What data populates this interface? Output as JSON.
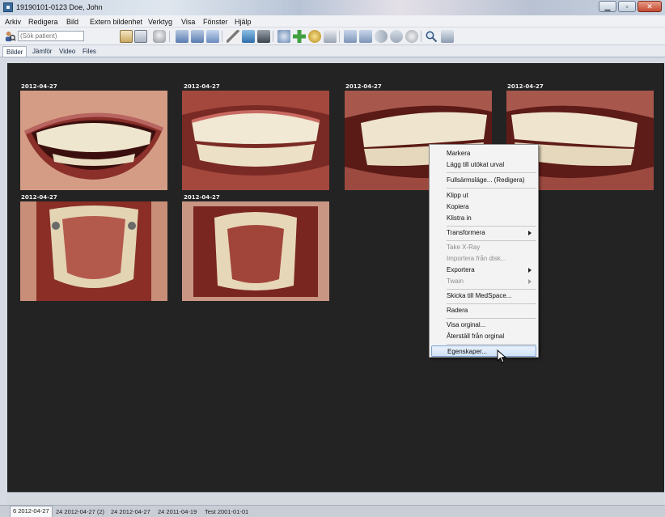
{
  "window": {
    "title": "19190101-0123 Doe, John"
  },
  "menubar": {
    "items": [
      "Arkiv",
      "Redigera",
      "Bild",
      "Extern bildenhet",
      "Verktyg",
      "Visa",
      "Fönster",
      "Hjälp"
    ]
  },
  "search": {
    "placeholder": "(Sök patient)"
  },
  "tabs": [
    "Bilder",
    "Jämför",
    "Video",
    "Files"
  ],
  "images": [
    {
      "date": "2012-04-27",
      "kind": "smile"
    },
    {
      "date": "2012-04-27",
      "kind": "frontal"
    },
    {
      "date": "2012-04-27",
      "kind": "right-lateral"
    },
    {
      "date": "2012-04-27",
      "kind": "left-lateral"
    },
    {
      "date": "2012-04-27",
      "kind": "upper-occlusal"
    },
    {
      "date": "2012-04-27",
      "kind": "lower-occlusal"
    }
  ],
  "context_menu": {
    "items": [
      {
        "label": "Markera"
      },
      {
        "label": "Lägg till utökat urval"
      },
      {
        "label": "Fullsärmsläge... (Redigera)"
      },
      {
        "label": "Klipp ut"
      },
      {
        "label": "Kopiera"
      },
      {
        "label": "Klistra in"
      },
      {
        "label": "Transformera",
        "submenu": true
      },
      {
        "label": "Take X-Ray",
        "disabled": true
      },
      {
        "label": "Importera från disk...",
        "disabled": true
      },
      {
        "label": "Exportera",
        "submenu": true
      },
      {
        "label": "Twain",
        "disabled": true,
        "submenu": true
      },
      {
        "label": "Skicka till MedSpace..."
      },
      {
        "label": "Radera"
      },
      {
        "label": "Visa orginal..."
      },
      {
        "label": "Återställ från orginal"
      },
      {
        "label": "Egenskaper...",
        "highlighted": true
      }
    ]
  },
  "sessions": [
    "6 2012-04-27",
    "24 2012-04-27 (2)",
    "24 2012-04-27",
    "24 2011-04-19",
    "Test 2001-01-01"
  ],
  "colors": {
    "background": "#232323",
    "highlight": "#cfe2f7",
    "close": "#c24a30"
  }
}
